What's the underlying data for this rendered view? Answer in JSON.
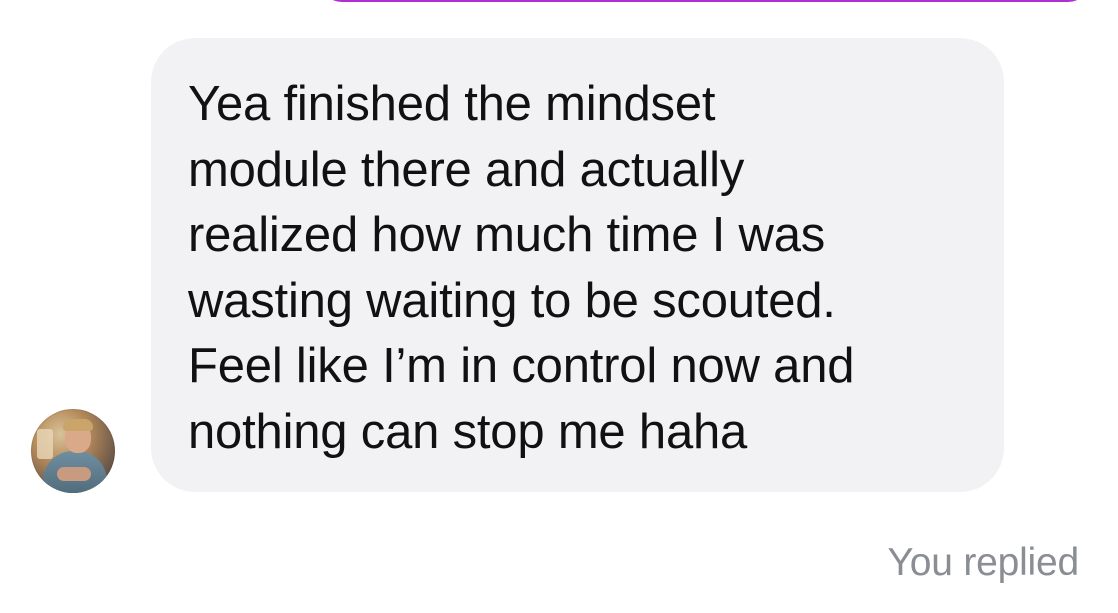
{
  "conversation": {
    "message": {
      "text": "Yea finished the mindset\nmodule there and actually\nrealized how much time I was\nwasting waiting to be scouted.\nFeel like I’m in control now and\nnothing can stop me haha"
    },
    "status": {
      "label": "You replied"
    },
    "colors": {
      "bubble_background": "#f2f2f5",
      "message_text": "#111111",
      "status_text": "#8a8d93",
      "previous_bubble_accent": "#b12fd0"
    },
    "icons": {
      "avatar": "user-avatar-photo"
    }
  }
}
